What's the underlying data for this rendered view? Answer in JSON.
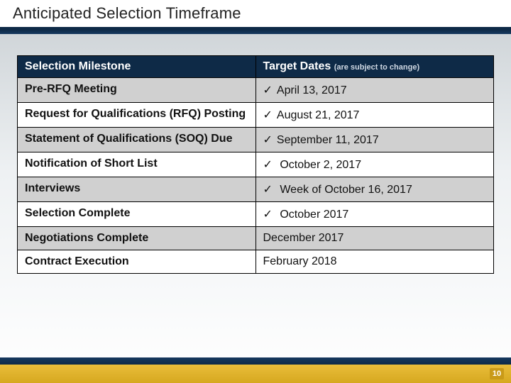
{
  "title": "Anticipated Selection Timeframe",
  "table": {
    "headers": {
      "milestone": "Selection Milestone",
      "dates": "Target Dates",
      "dates_note": "(are subject to change)"
    },
    "rows": [
      {
        "milestone": "Pre-RFQ Meeting",
        "date": "April 13, 2017",
        "checked": true,
        "alt": true
      },
      {
        "milestone": "Request for Qualifications (RFQ) Posting",
        "date": "August 21, 2017",
        "checked": true,
        "alt": false
      },
      {
        "milestone": "Statement of Qualifications (SOQ) Due",
        "date": "September 11, 2017",
        "checked": true,
        "alt": true
      },
      {
        "milestone": "Notification of Short List",
        "date": " October 2, 2017",
        "checked": true,
        "alt": false
      },
      {
        "milestone": "Interviews",
        "date": " Week of October 16, 2017",
        "checked": true,
        "alt": true
      },
      {
        "milestone": "Selection Complete",
        "date": " October 2017",
        "checked": true,
        "alt": false
      },
      {
        "milestone": "Negotiations Complete",
        "date": "December 2017",
        "checked": false,
        "alt": true
      },
      {
        "milestone": "Contract Execution",
        "date": "February 2018",
        "checked": false,
        "alt": false
      }
    ]
  },
  "checkmark": "✓",
  "page_number": "10"
}
